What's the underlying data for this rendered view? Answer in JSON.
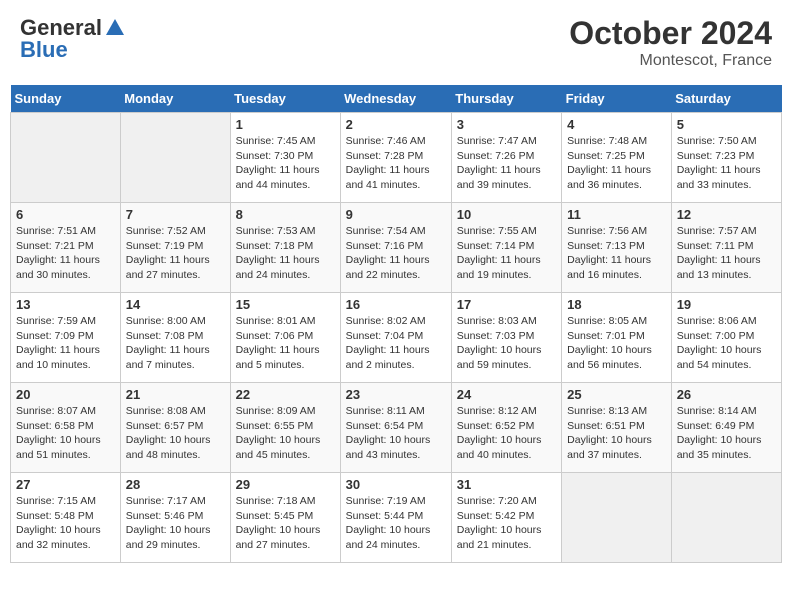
{
  "header": {
    "logo_general": "General",
    "logo_blue": "Blue",
    "month": "October 2024",
    "location": "Montescot, France"
  },
  "days_of_week": [
    "Sunday",
    "Monday",
    "Tuesday",
    "Wednesday",
    "Thursday",
    "Friday",
    "Saturday"
  ],
  "weeks": [
    [
      {
        "day": "",
        "info": ""
      },
      {
        "day": "",
        "info": ""
      },
      {
        "day": "1",
        "info": "Sunrise: 7:45 AM\nSunset: 7:30 PM\nDaylight: 11 hours and 44 minutes."
      },
      {
        "day": "2",
        "info": "Sunrise: 7:46 AM\nSunset: 7:28 PM\nDaylight: 11 hours and 41 minutes."
      },
      {
        "day": "3",
        "info": "Sunrise: 7:47 AM\nSunset: 7:26 PM\nDaylight: 11 hours and 39 minutes."
      },
      {
        "day": "4",
        "info": "Sunrise: 7:48 AM\nSunset: 7:25 PM\nDaylight: 11 hours and 36 minutes."
      },
      {
        "day": "5",
        "info": "Sunrise: 7:50 AM\nSunset: 7:23 PM\nDaylight: 11 hours and 33 minutes."
      }
    ],
    [
      {
        "day": "6",
        "info": "Sunrise: 7:51 AM\nSunset: 7:21 PM\nDaylight: 11 hours and 30 minutes."
      },
      {
        "day": "7",
        "info": "Sunrise: 7:52 AM\nSunset: 7:19 PM\nDaylight: 11 hours and 27 minutes."
      },
      {
        "day": "8",
        "info": "Sunrise: 7:53 AM\nSunset: 7:18 PM\nDaylight: 11 hours and 24 minutes."
      },
      {
        "day": "9",
        "info": "Sunrise: 7:54 AM\nSunset: 7:16 PM\nDaylight: 11 hours and 22 minutes."
      },
      {
        "day": "10",
        "info": "Sunrise: 7:55 AM\nSunset: 7:14 PM\nDaylight: 11 hours and 19 minutes."
      },
      {
        "day": "11",
        "info": "Sunrise: 7:56 AM\nSunset: 7:13 PM\nDaylight: 11 hours and 16 minutes."
      },
      {
        "day": "12",
        "info": "Sunrise: 7:57 AM\nSunset: 7:11 PM\nDaylight: 11 hours and 13 minutes."
      }
    ],
    [
      {
        "day": "13",
        "info": "Sunrise: 7:59 AM\nSunset: 7:09 PM\nDaylight: 11 hours and 10 minutes."
      },
      {
        "day": "14",
        "info": "Sunrise: 8:00 AM\nSunset: 7:08 PM\nDaylight: 11 hours and 7 minutes."
      },
      {
        "day": "15",
        "info": "Sunrise: 8:01 AM\nSunset: 7:06 PM\nDaylight: 11 hours and 5 minutes."
      },
      {
        "day": "16",
        "info": "Sunrise: 8:02 AM\nSunset: 7:04 PM\nDaylight: 11 hours and 2 minutes."
      },
      {
        "day": "17",
        "info": "Sunrise: 8:03 AM\nSunset: 7:03 PM\nDaylight: 10 hours and 59 minutes."
      },
      {
        "day": "18",
        "info": "Sunrise: 8:05 AM\nSunset: 7:01 PM\nDaylight: 10 hours and 56 minutes."
      },
      {
        "day": "19",
        "info": "Sunrise: 8:06 AM\nSunset: 7:00 PM\nDaylight: 10 hours and 54 minutes."
      }
    ],
    [
      {
        "day": "20",
        "info": "Sunrise: 8:07 AM\nSunset: 6:58 PM\nDaylight: 10 hours and 51 minutes."
      },
      {
        "day": "21",
        "info": "Sunrise: 8:08 AM\nSunset: 6:57 PM\nDaylight: 10 hours and 48 minutes."
      },
      {
        "day": "22",
        "info": "Sunrise: 8:09 AM\nSunset: 6:55 PM\nDaylight: 10 hours and 45 minutes."
      },
      {
        "day": "23",
        "info": "Sunrise: 8:11 AM\nSunset: 6:54 PM\nDaylight: 10 hours and 43 minutes."
      },
      {
        "day": "24",
        "info": "Sunrise: 8:12 AM\nSunset: 6:52 PM\nDaylight: 10 hours and 40 minutes."
      },
      {
        "day": "25",
        "info": "Sunrise: 8:13 AM\nSunset: 6:51 PM\nDaylight: 10 hours and 37 minutes."
      },
      {
        "day": "26",
        "info": "Sunrise: 8:14 AM\nSunset: 6:49 PM\nDaylight: 10 hours and 35 minutes."
      }
    ],
    [
      {
        "day": "27",
        "info": "Sunrise: 7:15 AM\nSunset: 5:48 PM\nDaylight: 10 hours and 32 minutes."
      },
      {
        "day": "28",
        "info": "Sunrise: 7:17 AM\nSunset: 5:46 PM\nDaylight: 10 hours and 29 minutes."
      },
      {
        "day": "29",
        "info": "Sunrise: 7:18 AM\nSunset: 5:45 PM\nDaylight: 10 hours and 27 minutes."
      },
      {
        "day": "30",
        "info": "Sunrise: 7:19 AM\nSunset: 5:44 PM\nDaylight: 10 hours and 24 minutes."
      },
      {
        "day": "31",
        "info": "Sunrise: 7:20 AM\nSunset: 5:42 PM\nDaylight: 10 hours and 21 minutes."
      },
      {
        "day": "",
        "info": ""
      },
      {
        "day": "",
        "info": ""
      }
    ]
  ]
}
